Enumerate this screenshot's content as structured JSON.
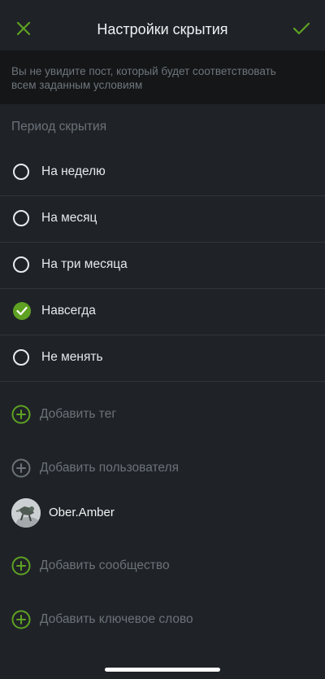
{
  "header": {
    "title": "Настройки скрытия"
  },
  "notice": {
    "text": "Вы не увидите пост, который будет соответствовать всем заданным условиям"
  },
  "period": {
    "section_title": "Период скрытия",
    "options": [
      {
        "label": "На неделю",
        "checked": false
      },
      {
        "label": "На месяц",
        "checked": false
      },
      {
        "label": "На три месяца",
        "checked": false
      },
      {
        "label": "Навсегда",
        "checked": true
      },
      {
        "label": "Не менять",
        "checked": false
      }
    ]
  },
  "filters": {
    "add_tag": "Добавить тег",
    "add_user": "Добавить пользователя",
    "user_name": "Ober.Amber",
    "add_community": "Добавить сообщество",
    "add_keyword": "Добавить ключевое слово"
  },
  "colors": {
    "accent": "#5fa122",
    "background": "#1f2328",
    "notice_bg": "#141618",
    "muted_text": "#6b7278"
  }
}
